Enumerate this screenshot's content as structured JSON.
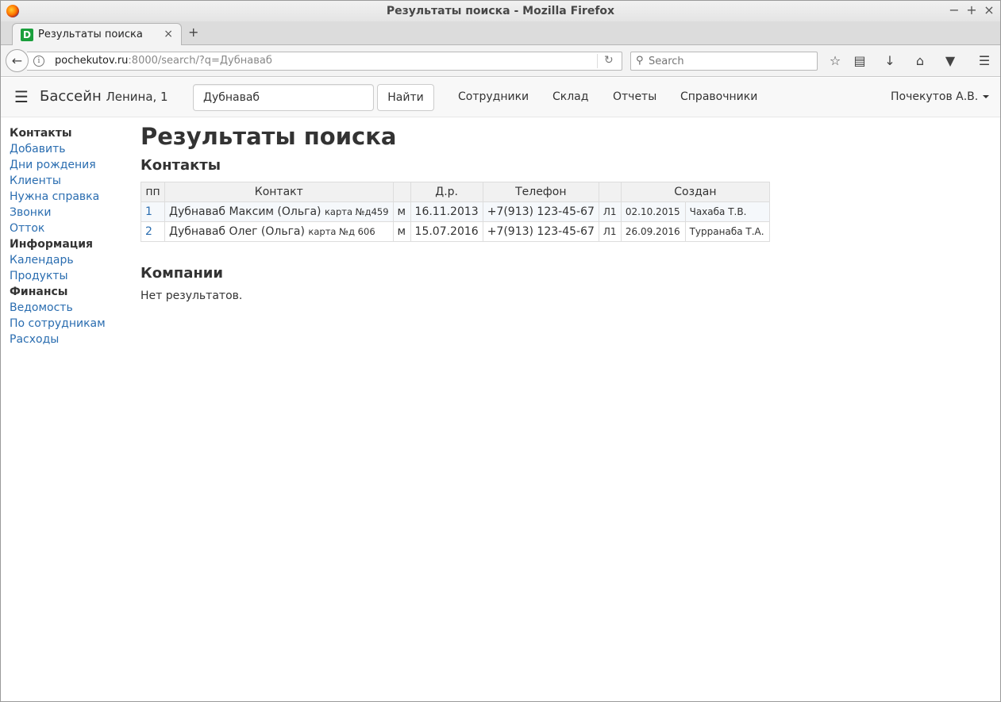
{
  "window": {
    "title": "Результаты поиска - Mozilla Firefox",
    "minimize": "−",
    "maximize": "+",
    "close": "×"
  },
  "tab": {
    "favicon_letter": "D",
    "label": "Результаты поиска",
    "close": "×",
    "new_tab": "+"
  },
  "navbar": {
    "url_host": "pochekutov.ru",
    "url_rest": ":8000/search/?q=Дубнаваб",
    "search_placeholder": "Search"
  },
  "app": {
    "brand": "Бассейн",
    "brand_sub": "Ленина, 1",
    "query": "Дубнаваб",
    "find_button": "Найти",
    "nav": [
      "Сотрудники",
      "Склад",
      "Отчеты",
      "Справочники"
    ],
    "user": "Почекутов А.В."
  },
  "sidebar": {
    "groups": [
      {
        "title": "Контакты",
        "items": [
          "Добавить",
          "Дни рождения",
          "Клиенты",
          "Нужна справка",
          "Звонки",
          "Отток"
        ]
      },
      {
        "title": "Информация",
        "items": [
          "Календарь",
          "Продукты"
        ]
      },
      {
        "title": "Финансы",
        "items": [
          "Ведомость",
          "По сотрудникам",
          "Расходы"
        ]
      }
    ]
  },
  "main": {
    "title": "Результаты поиска",
    "contacts_title": "Контакты",
    "table": {
      "headers": [
        "пп",
        "Контакт",
        "",
        "Д.р.",
        "Телефон",
        "",
        "Создан"
      ],
      "rows": [
        {
          "num": "1",
          "name": "Дубнаваб Максим (Ольга)",
          "card": "карта №д459",
          "gender": "м",
          "birth": "16.11.2013",
          "phone": "+7(913) 123-45-67",
          "code": "Л1",
          "created_date": "02.10.2015",
          "created_by": "Чахаба Т.В."
        },
        {
          "num": "2",
          "name": "Дубнаваб Олег (Ольга)",
          "card": "карта №д 606",
          "gender": "м",
          "birth": "15.07.2016",
          "phone": "+7(913) 123-45-67",
          "code": "Л1",
          "created_date": "26.09.2016",
          "created_by": "Турранаба Т.А."
        }
      ]
    },
    "companies_title": "Компании",
    "no_results": "Нет результатов."
  }
}
